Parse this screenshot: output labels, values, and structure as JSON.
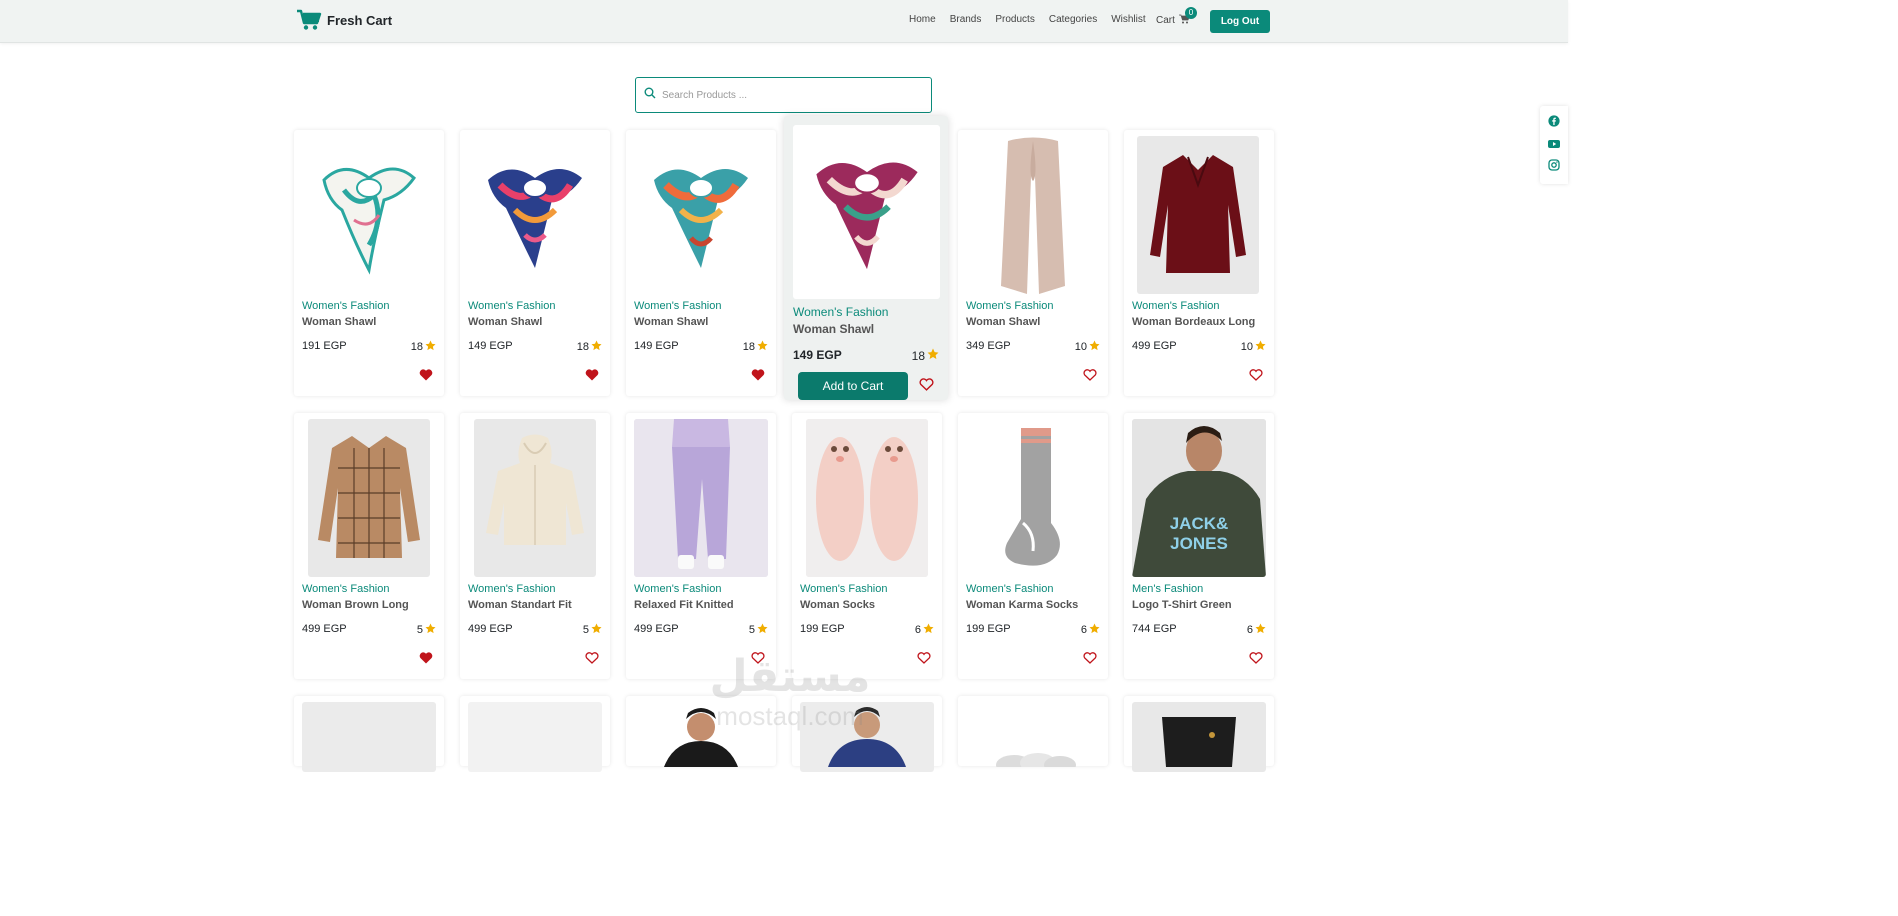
{
  "navbar": {
    "brand": "Fresh Cart",
    "links": [
      "Home",
      "Brands",
      "Products",
      "Categories",
      "Wishlist"
    ],
    "cart_label": "Cart",
    "cart_count": "0",
    "logout_label": "Log Out"
  },
  "search": {
    "placeholder": "Search Products ..."
  },
  "colors": {
    "accent": "#0b8a7a",
    "heart": "#c0141b",
    "star": "#f0ad00"
  },
  "product_action": {
    "add_to_cart": "Add to Cart"
  },
  "products": [
    {
      "category": "Women's Fashion",
      "title": "Woman Shawl",
      "price": "191 EGP",
      "rating": "18",
      "wishlisted": true
    },
    {
      "category": "Women's Fashion",
      "title": "Woman Shawl",
      "price": "149 EGP",
      "rating": "18",
      "wishlisted": true
    },
    {
      "category": "Women's Fashion",
      "title": "Woman Shawl",
      "price": "149 EGP",
      "rating": "18",
      "wishlisted": true
    },
    {
      "category": "Women's Fashion",
      "title": "Woman Shawl",
      "price": "149 EGP",
      "rating": "18",
      "wishlisted": false
    },
    {
      "category": "Women's Fashion",
      "title": "Woman Shawl",
      "price": "349 EGP",
      "rating": "10",
      "wishlisted": false
    },
    {
      "category": "Women's Fashion",
      "title": "Woman Bordeaux Long",
      "price": "499 EGP",
      "rating": "10",
      "wishlisted": false
    },
    {
      "category": "Women's Fashion",
      "title": "Woman Brown Long",
      "price": "499 EGP",
      "rating": "5",
      "wishlisted": true
    },
    {
      "category": "Women's Fashion",
      "title": "Woman Standart Fit",
      "price": "499 EGP",
      "rating": "5",
      "wishlisted": false
    },
    {
      "category": "Women's Fashion",
      "title": "Relaxed Fit Knitted",
      "price": "499 EGP",
      "rating": "5",
      "wishlisted": false
    },
    {
      "category": "Women's Fashion",
      "title": "Woman Socks",
      "price": "199 EGP",
      "rating": "6",
      "wishlisted": false
    },
    {
      "category": "Women's Fashion",
      "title": "Woman Karma Socks",
      "price": "199 EGP",
      "rating": "6",
      "wishlisted": false
    },
    {
      "category": "Men's Fashion",
      "title": "Logo T-Shirt Green",
      "price": "744 EGP",
      "rating": "6",
      "wishlisted": false
    }
  ],
  "overlay_watermark": {
    "arabic": "مستقل",
    "latin": "mostaql.com"
  }
}
